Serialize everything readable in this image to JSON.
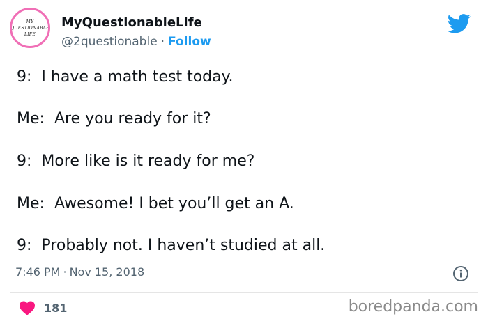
{
  "author": {
    "display_name": "MyQuestionableLife",
    "handle": "@2questionable",
    "separator": "·",
    "follow_label": "Follow",
    "avatar_lines": [
      "MY",
      "QUESTIONABLE",
      "LIFE"
    ]
  },
  "tweet": {
    "lines": [
      {
        "speaker": "9:",
        "text": "I have a math test today."
      },
      {
        "speaker": "Me:",
        "text": "Are you ready for it?"
      },
      {
        "speaker": "9:",
        "text": "More like is it ready for me?"
      },
      {
        "speaker": "Me:",
        "text": "Awesome! I bet you’ll get an A."
      },
      {
        "speaker": "9:",
        "text": "Probably not. I haven’t studied at all."
      }
    ],
    "time": "7:46 PM",
    "date": "Nov 15, 2018",
    "like_count": "181"
  },
  "watermark": "boredpanda.com",
  "colors": {
    "accent": "#1d9bf0",
    "heart": "#f91880",
    "avatar_ring": "#f06fb6"
  },
  "icons": [
    "twitter-bird-icon",
    "info-icon",
    "heart-icon"
  ]
}
